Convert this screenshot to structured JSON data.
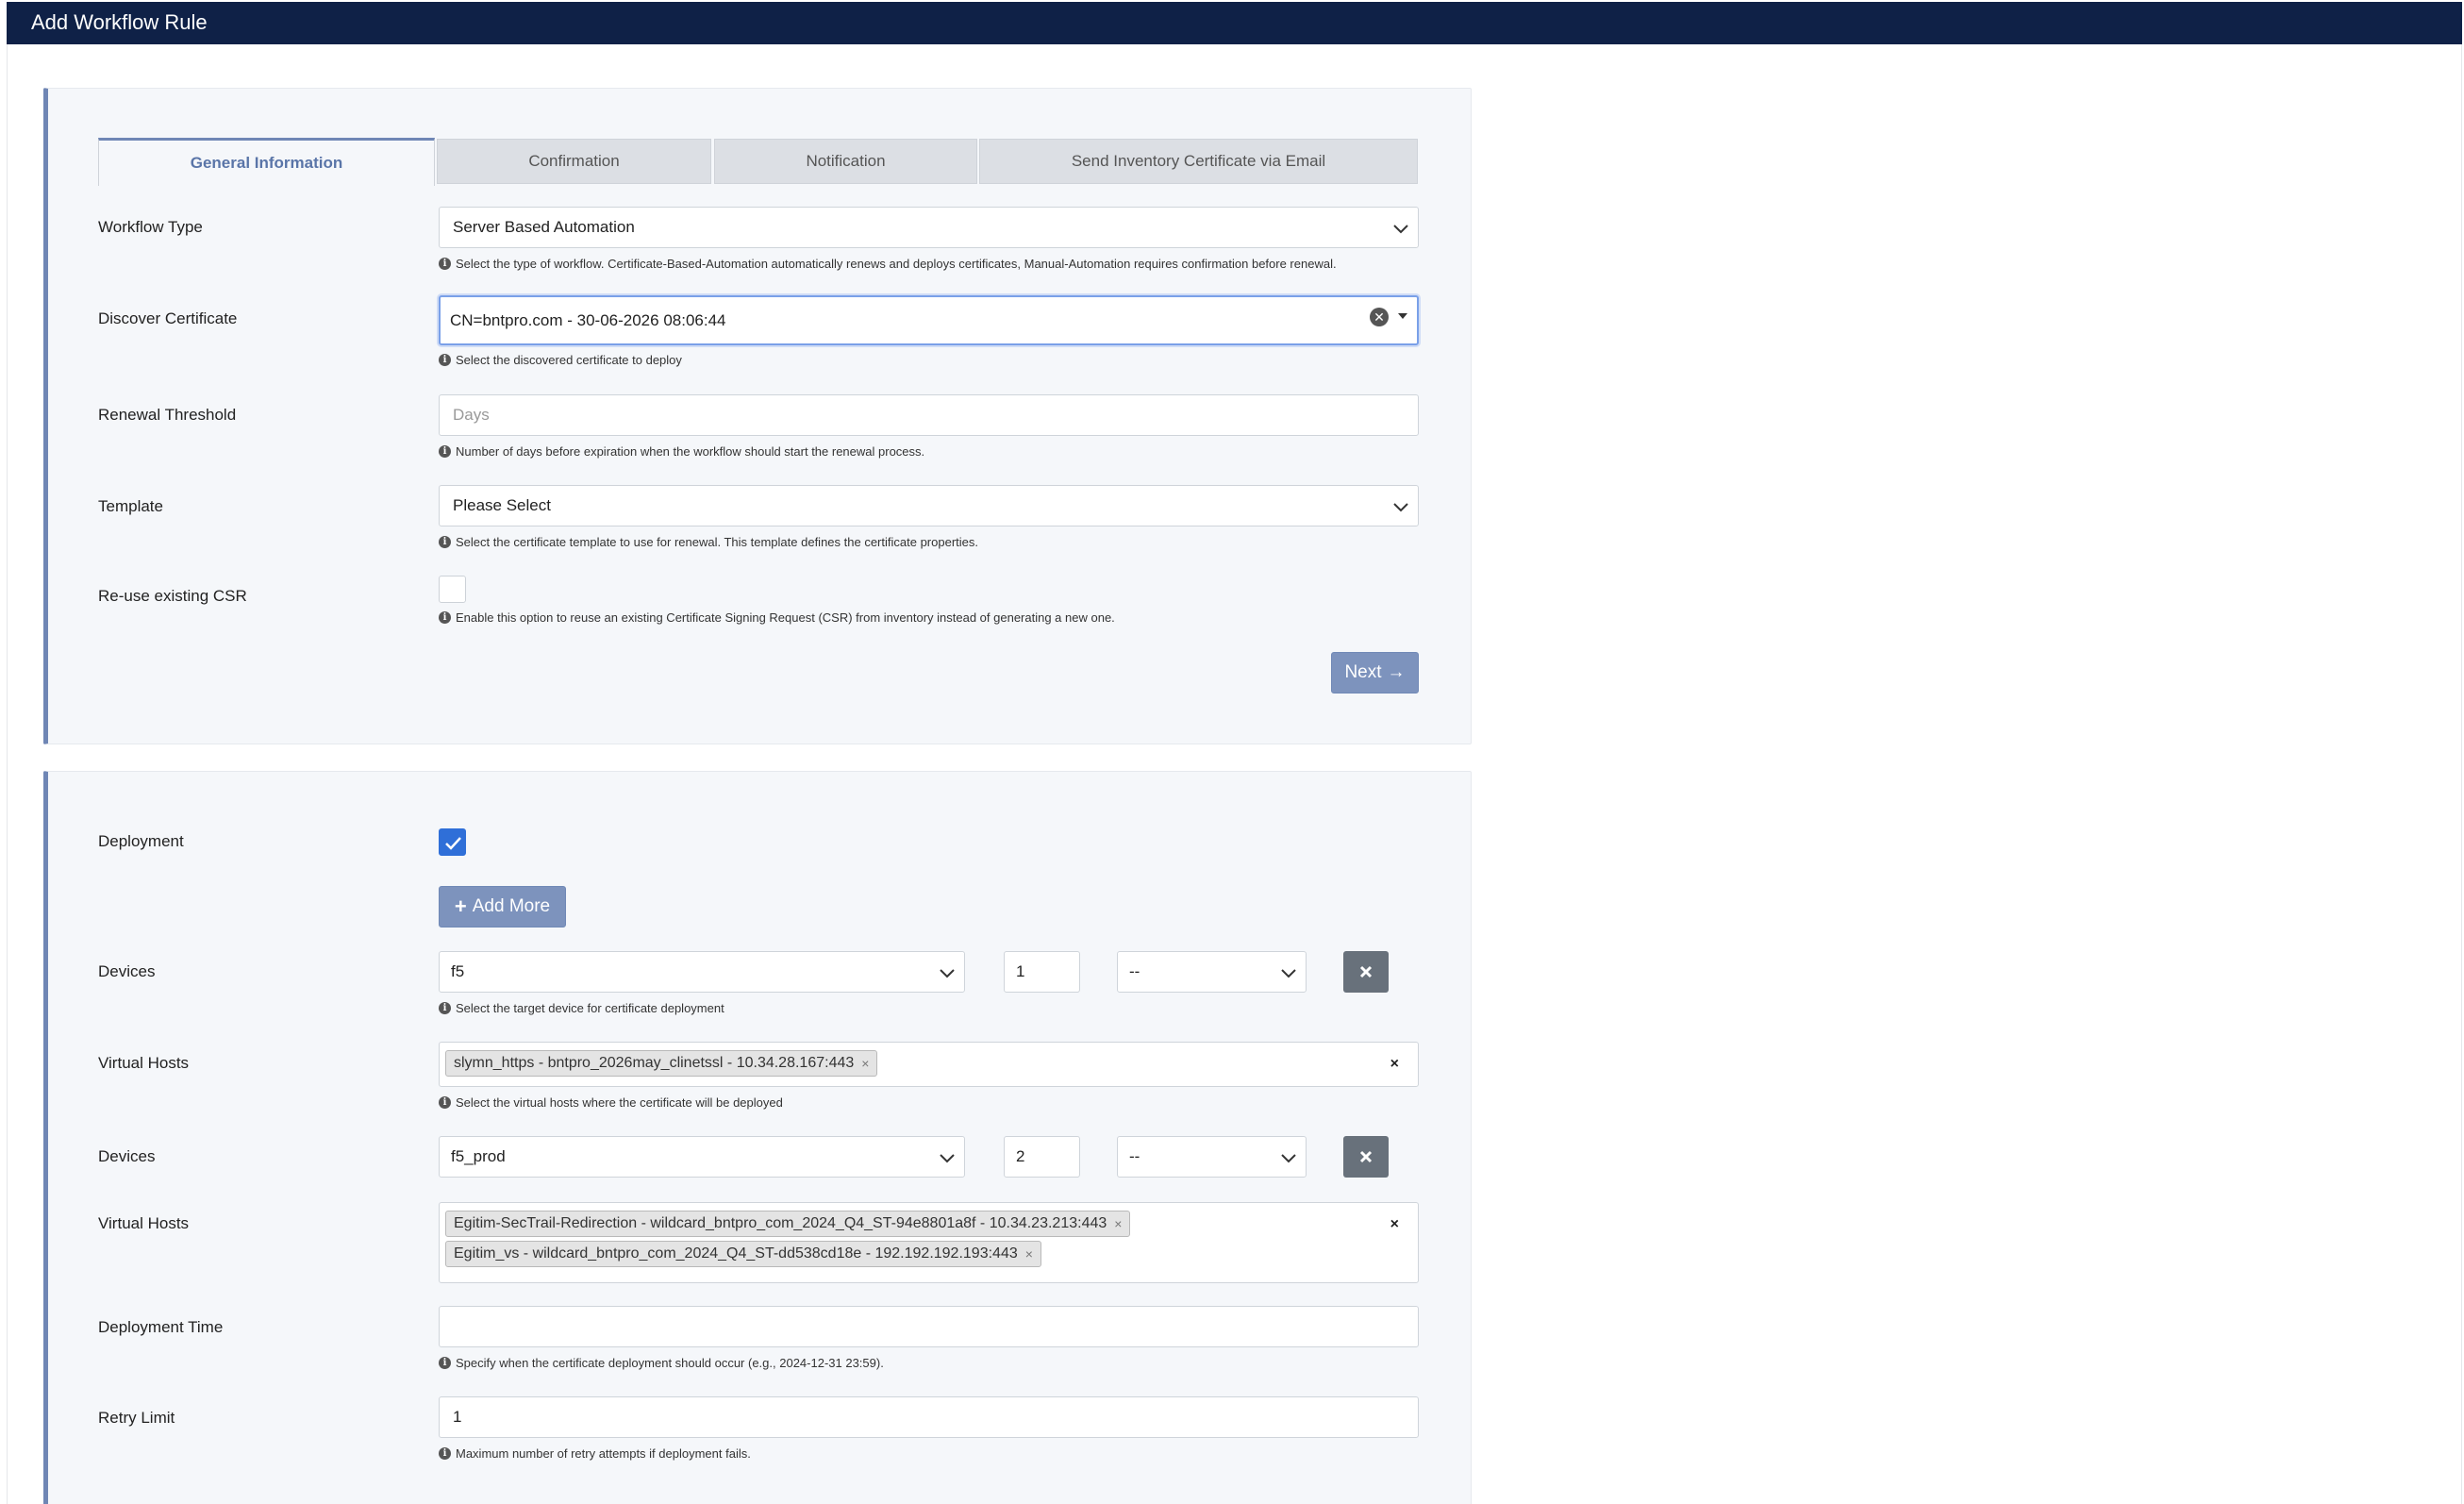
{
  "app": {
    "title": "Add Workflow Rule"
  },
  "tabs": [
    {
      "label": "General Information",
      "active": true
    },
    {
      "label": "Confirmation",
      "active": false
    },
    {
      "label": "Notification",
      "active": false
    },
    {
      "label": "Send Inventory Certificate via Email",
      "active": false
    }
  ],
  "general": {
    "workflow_type": {
      "label": "Workflow Type",
      "value": "Server Based Automation",
      "help": "Select the type of workflow. Certificate-Based-Automation automatically renews and deploys certificates, Manual-Automation requires confirmation before renewal."
    },
    "discover_certificate": {
      "label": "Discover Certificate",
      "value": "CN=bntpro.com - 30-06-2026 08:06:44",
      "help": "Select the discovered certificate to deploy"
    },
    "renewal_threshold": {
      "label": "Renewal Threshold",
      "placeholder": "Days",
      "help": "Number of days before expiration when the workflow should start the renewal process."
    },
    "template": {
      "label": "Template",
      "value": "Please Select",
      "help": "Select the certificate template to use for renewal. This template defines the certificate properties."
    },
    "reuse_csr": {
      "label": "Re-use existing CSR",
      "checked": false,
      "help": "Enable this option to reuse an existing Certificate Signing Request (CSR) from inventory instead of generating a new one."
    },
    "next_label": "Next"
  },
  "deployment": {
    "label": "Deployment",
    "checked": true,
    "add_more_label": "Add More",
    "devices_label": "Devices",
    "virtual_hosts_label": "Virtual Hosts",
    "device_help": "Select the target device for certificate deployment",
    "virtual_hosts_help": "Select the virtual hosts where the certificate will be deployed",
    "rows": [
      {
        "device": "f5",
        "order": "1",
        "option": "--",
        "virtual_hosts": [
          "slymn_https - bntpro_2026may_clinetssl - 10.34.28.167:443"
        ]
      },
      {
        "device": "f5_prod",
        "order": "2",
        "option": "--",
        "virtual_hosts": [
          "Egitim-SecTrail-Redirection - wildcard_bntpro_com_2024_Q4_ST-94e8801a8f - 10.34.23.213:443",
          "Egitim_vs - wildcard_bntpro_com_2024_Q4_ST-dd538cd18e - 192.192.192.193:443"
        ]
      }
    ],
    "deployment_time": {
      "label": "Deployment Time",
      "value": "",
      "help": "Specify when the certificate deployment should occur (e.g., 2024-12-31 23:59)."
    },
    "retry_limit": {
      "label": "Retry Limit",
      "value": "1",
      "help": "Maximum number of retry attempts if deployment fails."
    }
  },
  "colors": {
    "header_bg": "#0f2147",
    "accent": "#6f86b5",
    "button": "#7d93bd",
    "checkbox_checked": "#2f6fd8"
  }
}
